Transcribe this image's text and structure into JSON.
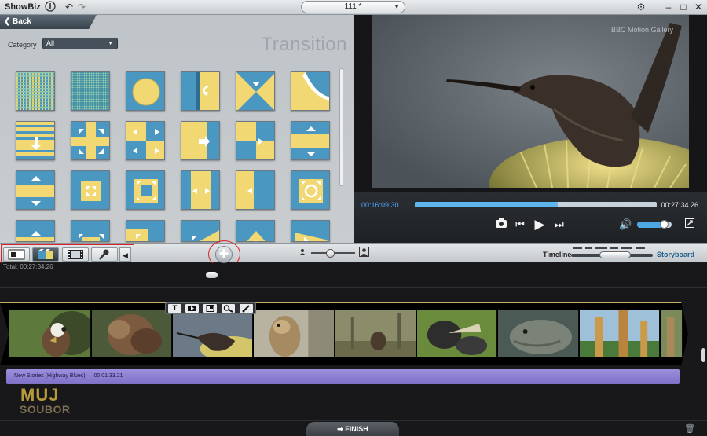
{
  "app": {
    "name": "ShowBiz",
    "project_name": "111 *"
  },
  "panel": {
    "back_label": "Back",
    "category_label": "Category",
    "category_value": "All",
    "heading": "Transition"
  },
  "preview": {
    "watermark": "BBC Motion Gallery",
    "current_time": "00:16:09.30",
    "total_time": "00:27:34.26",
    "progress": 0.59,
    "volume": 0.8
  },
  "modebar": {
    "timeline_label": "Timeline",
    "storyboard_label": "Storyboard",
    "zoom_level": 0.45
  },
  "timeline": {
    "total_label": "Total:   00:27:34.26",
    "audio_clip_label": "New Stories (Highway Blues) — 00:01:33.21"
  },
  "clip_tools": [
    "T",
    "",
    "",
    "",
    ""
  ],
  "logo": {
    "top": "MUJ",
    "bottom": "SOUBOR"
  },
  "footer": {
    "finish_label": "FINISH"
  },
  "colors": {
    "accent_blue": "#4a97c2",
    "accent_yellow": "#f2d873",
    "audio_track": "#8f80d4",
    "highlight_red": "#d8232a"
  },
  "icons": [
    "info-icon",
    "undo-icon",
    "redo-icon",
    "gear-icon",
    "minimize-icon",
    "maximize-icon",
    "close-icon",
    "snapshot-icon",
    "previous-icon",
    "play-icon",
    "next-icon",
    "volume-icon",
    "fullscreen-icon",
    "trash-icon"
  ]
}
